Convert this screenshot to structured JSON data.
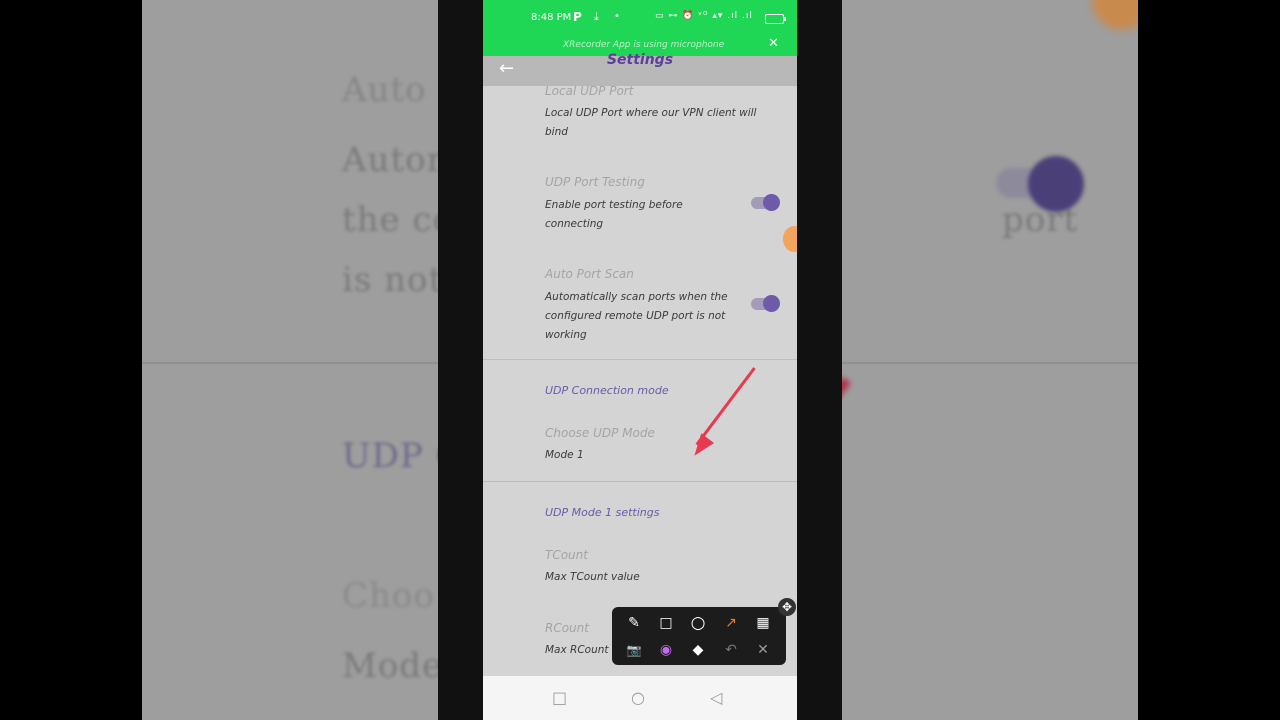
{
  "background": {
    "text_line_1": "Auto",
    "text_line_2": "Autom",
    "text_line_3": "the co",
    "text_line_3b": "port",
    "text_line_4": "is not",
    "text_line_5": "UDP C",
    "text_line_6": "Choo",
    "text_line_7": "Mode"
  },
  "status_bar": {
    "time": "8:48 PM",
    "app_letter": "P",
    "download_icon": "⤓",
    "dot": "•",
    "right_icons": "▭ ⊶ ⏰ ᵛᴼ ▴▾ .ıl .ıl",
    "notice": "XRecorder App is using microphone",
    "close_icon": "✕"
  },
  "app_bar": {
    "back_icon": "←",
    "title": "Settings"
  },
  "settings": {
    "local_udp_port": {
      "title": "Local UDP Port",
      "summary": "Local UDP Port where our VPN client will bind"
    },
    "udp_port_testing": {
      "title": "UDP Port Testing",
      "summary": "Enable port testing before connecting",
      "enabled": true
    },
    "auto_port_scan": {
      "title": "Auto Port Scan",
      "summary": "Automatically scan ports when the configured remote UDP port is not working",
      "enabled": true
    },
    "udp_connection_mode_category": "UDP Connection mode",
    "choose_udp_mode": {
      "title": "Choose UDP Mode",
      "value": "Mode 1"
    },
    "udp_mode1_category": "UDP Mode 1 settings",
    "tcount": {
      "title": "TCount",
      "summary": "Max TCount value"
    },
    "rcount": {
      "title": "RCount",
      "summary": "Max RCount"
    }
  },
  "annotation_toolbar": {
    "pen": "✎",
    "rectangle": "□",
    "circle": "○",
    "arrow": "↗",
    "mosaic": "▦",
    "camera": "📷",
    "color": "◉",
    "eraser": "◆",
    "undo": "↶",
    "close": "✕",
    "move": "✥"
  },
  "nav_bar": {
    "recents": "□",
    "home": "○",
    "back": "◁"
  },
  "colors": {
    "status_green": "#1fd655",
    "accent_purple": "#6e5aa8",
    "arrow_red": "#e8394f"
  }
}
